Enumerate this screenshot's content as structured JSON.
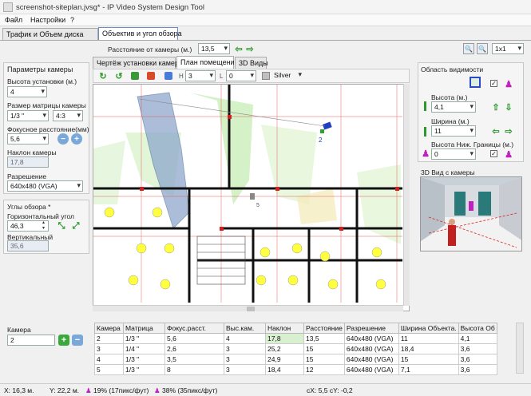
{
  "window": {
    "title": "screenshot-siteplan.jvsg* - IP Video System Design Tool"
  },
  "menu": [
    "Файл",
    "Настройки",
    "?"
  ],
  "main_tabs": [
    "Трафик и Объем диска",
    "Объектив и угол обзора"
  ],
  "distance": {
    "label": "Расстояние от камеры (м.)",
    "value": "13,5"
  },
  "zoom": {
    "value": "1x1"
  },
  "camera_params": {
    "title": "Параметры камеры",
    "height_label": "Высота установки (м.)",
    "height_value": "4",
    "matrix_label": "Размер матрицы камеры",
    "matrix_value": "1/3 \"",
    "aspect_value": "4:3",
    "focal_label": "Фокусное расстояние(мм)",
    "focal_value": "5,6",
    "tilt_label": "Наклон камеры",
    "tilt_value": "17,8",
    "resolution_label": "Разрешение",
    "resolution_value": "640x480 (VGA)"
  },
  "angles": {
    "title": "Углы обзора *",
    "horizontal_label": "Горизонтальный угол",
    "horizontal_value": "46,3",
    "vertical_label": "Вертикальный",
    "vertical_value": "35,6"
  },
  "view_tabs": [
    "Чертёж установки камеры",
    "План помещений",
    "3D Виды"
  ],
  "plan_toolbar": {
    "h_label": "H",
    "h_value": "3",
    "l_label": "L",
    "l_value": "0",
    "color_value": "Silver"
  },
  "plan": {
    "camera2_label": "2",
    "camera5_label": "5"
  },
  "visibility": {
    "title": "Область видимости",
    "height_label": "Высота (м.)",
    "height_value": "4,1",
    "width_label": "Ширина (м.)",
    "width_value": "11",
    "lower_label": "Высота Ниж. Границы (м.)",
    "lower_value": "0"
  },
  "view3d": {
    "title": "3D Вид с камеры"
  },
  "camera_field": {
    "label": "Камера",
    "value": "2"
  },
  "table": {
    "headers": [
      "Камера",
      "Матрица",
      "Фокус.расст.",
      "Выс.кам.",
      "Наклон",
      "Расстояние",
      "Разрешение",
      "Ширина Объекта.",
      "Высота Об"
    ],
    "rows": [
      [
        "2",
        "1/3 \"",
        "5,6",
        "4",
        "17,8",
        "13,5",
        "640x480 (VGA)",
        "11",
        "4,1"
      ],
      [
        "3",
        "1/4 \"",
        "2,6",
        "3",
        "25,2",
        "15",
        "640x480 (VGA)",
        "18,4",
        "3,6"
      ],
      [
        "4",
        "1/3 \"",
        "3,5",
        "3",
        "24,9",
        "15",
        "640x480 (VGA)",
        "15",
        "3,6"
      ],
      [
        "5",
        "1/3 \"",
        "8",
        "3",
        "18,4",
        "12",
        "640x480 (VGA)",
        "7,1",
        "3,6"
      ]
    ]
  },
  "status": {
    "x": "X: 16,3 м.",
    "y": "Y: 22,2 м.",
    "p1": "19% (17пикс/фут)",
    "p2": "38% (35пикс/фут)",
    "cxy": "cX: 5,5 cY: -0,2"
  }
}
